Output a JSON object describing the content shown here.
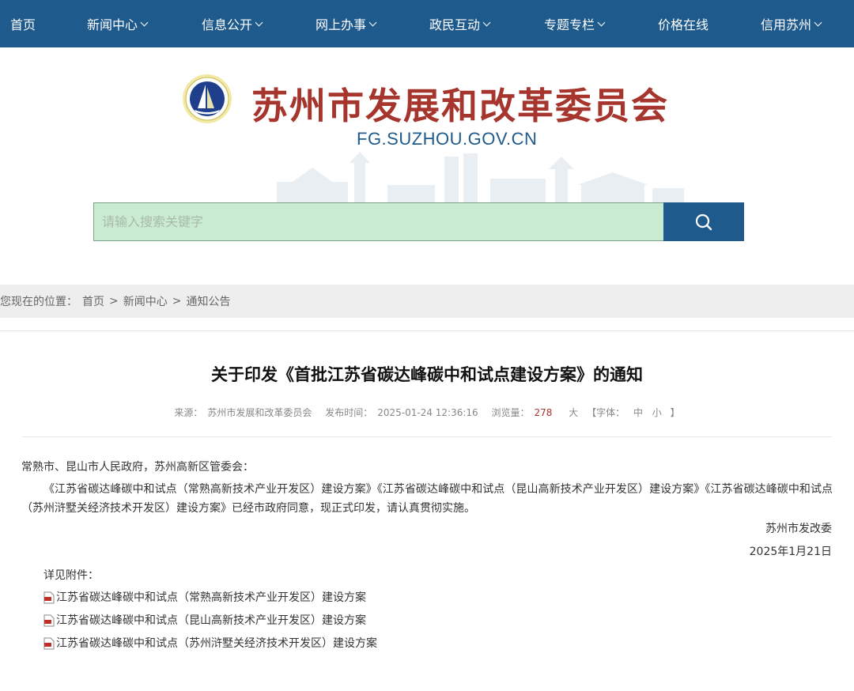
{
  "nav": {
    "items": [
      {
        "label": "首页",
        "dropdown": false
      },
      {
        "label": "新闻中心",
        "dropdown": true
      },
      {
        "label": "信息公开",
        "dropdown": true
      },
      {
        "label": "网上办事",
        "dropdown": true
      },
      {
        "label": "政民互动",
        "dropdown": true
      },
      {
        "label": "专题专栏",
        "dropdown": true
      },
      {
        "label": "价格在线",
        "dropdown": false
      },
      {
        "label": "信用苏州",
        "dropdown": true
      }
    ]
  },
  "header": {
    "title": "苏州市发展和改革委员会",
    "domain": "FG.SUZHOU.GOV.CN"
  },
  "search": {
    "placeholder": "请输入搜索关键字",
    "icon": "search-icon"
  },
  "breadcrumb": {
    "prefix": "您现在的位置：",
    "items": [
      "首页",
      "新闻中心",
      "通知公告"
    ],
    "separator": ">"
  },
  "article": {
    "title": "关于印发《首批江苏省碳达峰碳中和试点建设方案》的通知",
    "meta": {
      "source_label": "来源：",
      "source": "苏州市发展和改革委员会",
      "time_label": "发布时间：",
      "time": "2025-01-24 12:36:16",
      "views_label": "浏览量：",
      "views": "278",
      "size_large": "大",
      "font_label": "【字体：",
      "size_medium": "中",
      "size_small": "小",
      "font_end": "】"
    },
    "salutation": "常熟市、昆山市人民政府，苏州高新区管委会：",
    "paragraph": "《江苏省碳达峰碳中和试点（常熟高新技术产业开发区）建设方案》《江苏省碳达峰碳中和试点（昆山高新技术产业开发区）建设方案》《江苏省碳达峰碳中和试点（苏州浒墅关经济技术开发区）建设方案》已经市政府同意，现正式印发，请认真贯彻实施。",
    "signature": "苏州市发改委",
    "date": "2025年1月21日",
    "attachments_label": "详见附件：",
    "attachments": [
      "江苏省碳达峰碳中和试点（常熟高新技术产业开发区）建设方案",
      "江苏省碳达峰碳中和试点（昆山高新技术产业开发区）建设方案",
      "江苏省碳达峰碳中和试点（苏州浒墅关经济技术开发区）建设方案"
    ]
  },
  "colors": {
    "nav_bg": "#1f5a8c",
    "title_red": "#a6352d",
    "search_bg": "#c9ecd1"
  }
}
